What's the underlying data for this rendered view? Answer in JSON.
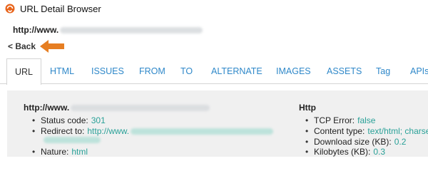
{
  "window": {
    "title": "URL Detail Browser"
  },
  "page": {
    "url_prefix": "http://www."
  },
  "nav": {
    "back_label": "< Back"
  },
  "tabs": [
    {
      "label": "URL"
    },
    {
      "label": "HTML"
    },
    {
      "label": "ISSUES"
    },
    {
      "label": "FROM"
    },
    {
      "label": "TO"
    },
    {
      "label": "ALTERNATE"
    },
    {
      "label": "IMAGES"
    },
    {
      "label": "ASSETS"
    },
    {
      "label": "Tag"
    },
    {
      "label": "APIs"
    }
  ],
  "url_section": {
    "title_prefix": "http://www.",
    "status_label": "Status code:",
    "status_value": "301",
    "redirect_label": "Redirect to:",
    "redirect_value_prefix": "http://www.",
    "nature_label": "Nature:",
    "nature_value": "html"
  },
  "http_section": {
    "title": "Http",
    "tcp_label": "TCP Error:",
    "tcp_value": "false",
    "ctype_label": "Content type:",
    "ctype_value": "text/html; charse",
    "dlsize_label": "Download size (KB):",
    "dlsize_value": "0.2",
    "kb_label": "Kilobytes (KB):",
    "kb_value": "0.3"
  },
  "colors": {
    "link": "#2f88c9",
    "value": "#2aa198",
    "arrow": "#e67e22",
    "panel": "#f0f0f0"
  }
}
